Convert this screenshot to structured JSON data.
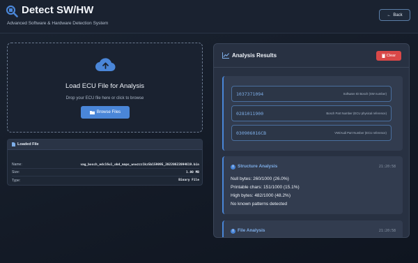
{
  "header": {
    "title": "Detect SW/HW",
    "subtitle": "Advanced Software & Hardware Detection System",
    "back_label": "Back"
  },
  "upload": {
    "title": "Load ECU File for Analysis",
    "subtitle": "Drop your ECU file here or click to browse",
    "browse_label": "Browse Files"
  },
  "loaded_file": {
    "heading": "Loaded File",
    "rows": [
      {
        "label": "Name:",
        "value": "vag_bosch_edc16u1_obd_maps_wvwzzz1kz5b159095_20220622094619.bin"
      },
      {
        "label": "Size:",
        "value": "1.00 MB"
      },
      {
        "label": "Type:",
        "value": "Binary File"
      }
    ]
  },
  "results": {
    "title": "Analysis Results",
    "clear_label": "Clear",
    "part_numbers": [
      {
        "value": "1037371094",
        "description": "Software ID Bosch (SW number)"
      },
      {
        "value": "0281011900",
        "description": "Bosch Part Number (ECU physical reference)"
      },
      {
        "value": "030906016CB",
        "description": "VW/Audi Part Number (ECU reference)"
      }
    ],
    "structure": {
      "title": "Structure Analysis",
      "time": "21:20:58",
      "lines": [
        "Null bytes: 260/1000 (26.0%)",
        "Printable chars: 151/1000 (15.1%)",
        "High bytes: 482/1000 (48.2%)",
        "No known patterns detected"
      ]
    },
    "file_analysis": {
      "title": "File Analysis",
      "time": "21:20:58"
    }
  },
  "colors": {
    "accent": "#4a86d8",
    "danger": "#d94848",
    "background": "#141b27"
  }
}
